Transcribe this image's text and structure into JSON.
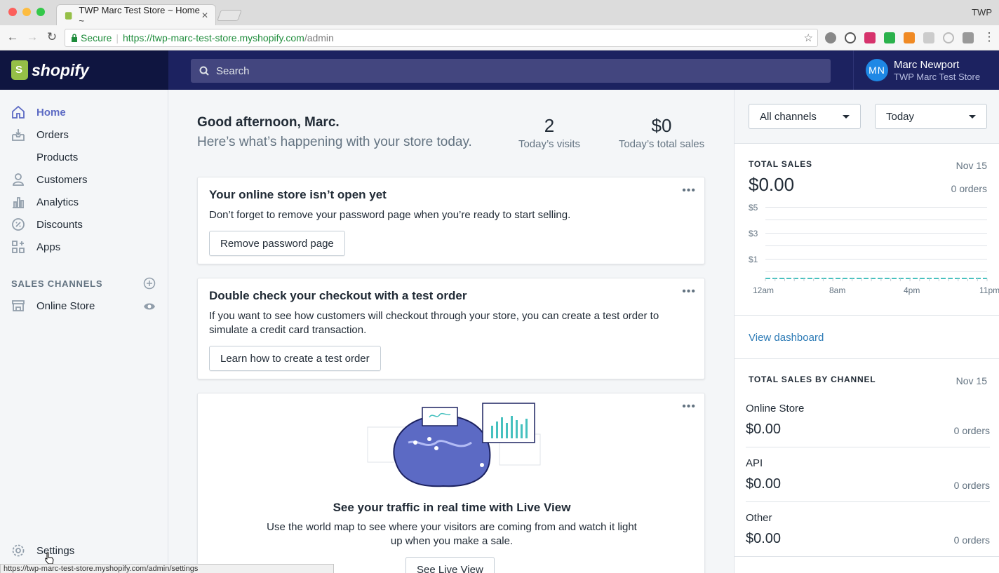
{
  "browser": {
    "tab_title": "TWP Marc Test Store ~ Home ~",
    "profile": "TWP",
    "secure_label": "Secure",
    "url_host": "https://twp-marc-test-store.myshopify.com",
    "url_path": "/admin",
    "status_url": "https://twp-marc-test-store.myshopify.com/admin/settings"
  },
  "topbar": {
    "logo": "shopify",
    "search_placeholder": "Search",
    "user_initials": "MN",
    "user_name": "Marc Newport",
    "store_name": "TWP Marc Test Store"
  },
  "sidebar": {
    "items": [
      {
        "label": "Home",
        "icon": "home-icon"
      },
      {
        "label": "Orders",
        "icon": "orders-icon"
      },
      {
        "label": "Products",
        "icon": "products-icon"
      },
      {
        "label": "Customers",
        "icon": "customers-icon"
      },
      {
        "label": "Analytics",
        "icon": "analytics-icon"
      },
      {
        "label": "Discounts",
        "icon": "discounts-icon"
      },
      {
        "label": "Apps",
        "icon": "apps-icon"
      }
    ],
    "sales_channels_heading": "SALES CHANNELS",
    "online_store": "Online Store",
    "settings": "Settings"
  },
  "main": {
    "greeting": "Good afternoon, Marc.",
    "subgreeting": "Here’s what’s happening with your store today.",
    "visits_value": "2",
    "visits_label": "Today’s visits",
    "sales_value": "$0",
    "sales_label": "Today’s total sales",
    "cards": [
      {
        "title": "Your online store isn’t open yet",
        "body": "Don’t forget to remove your password page when you’re ready to start selling.",
        "button": "Remove password page"
      },
      {
        "title": "Double check your checkout with a test order",
        "body": "If you want to see how customers will checkout through your store, you can create a test order to simulate a credit card transaction.",
        "button": "Learn how to create a test order"
      },
      {
        "title": "See your traffic in real time with Live View",
        "body": "Use the world map to see where your visitors are coming from and watch it light up when you make a sale.",
        "button": "See Live View"
      }
    ]
  },
  "right": {
    "channel_filter": "All channels",
    "date_filter": "Today",
    "total_sales_heading": "TOTAL SALES",
    "total_sales_date": "Nov 15",
    "total_sales_value": "$0.00",
    "total_sales_orders": "0 orders",
    "view_dashboard": "View dashboard",
    "by_channel_heading": "TOTAL SALES BY CHANNEL",
    "by_channel_date": "Nov 15",
    "channels": [
      {
        "name": "Online Store",
        "value": "$0.00",
        "orders": "0 orders"
      },
      {
        "name": "API",
        "value": "$0.00",
        "orders": "0 orders"
      },
      {
        "name": "Other",
        "value": "$0.00",
        "orders": "0 orders"
      }
    ]
  },
  "chart_data": {
    "type": "line",
    "x_tick_labels": [
      "12am",
      "8am",
      "4pm",
      "11pm"
    ],
    "y_tick_labels": [
      "$5",
      "$3",
      "$1"
    ],
    "series": [
      {
        "values": [
          0,
          0,
          0,
          0,
          0,
          0,
          0,
          0,
          0,
          0,
          0,
          0,
          0,
          0,
          0,
          0,
          0,
          0,
          0,
          0,
          0,
          0,
          0,
          0
        ]
      }
    ],
    "ylim": [
      0,
      5
    ],
    "grid": true
  },
  "colors": {
    "topbar": "#1c2260",
    "accent": "#5c6ac4",
    "link": "#2d7bb6",
    "chart_line": "#47c1bf"
  }
}
